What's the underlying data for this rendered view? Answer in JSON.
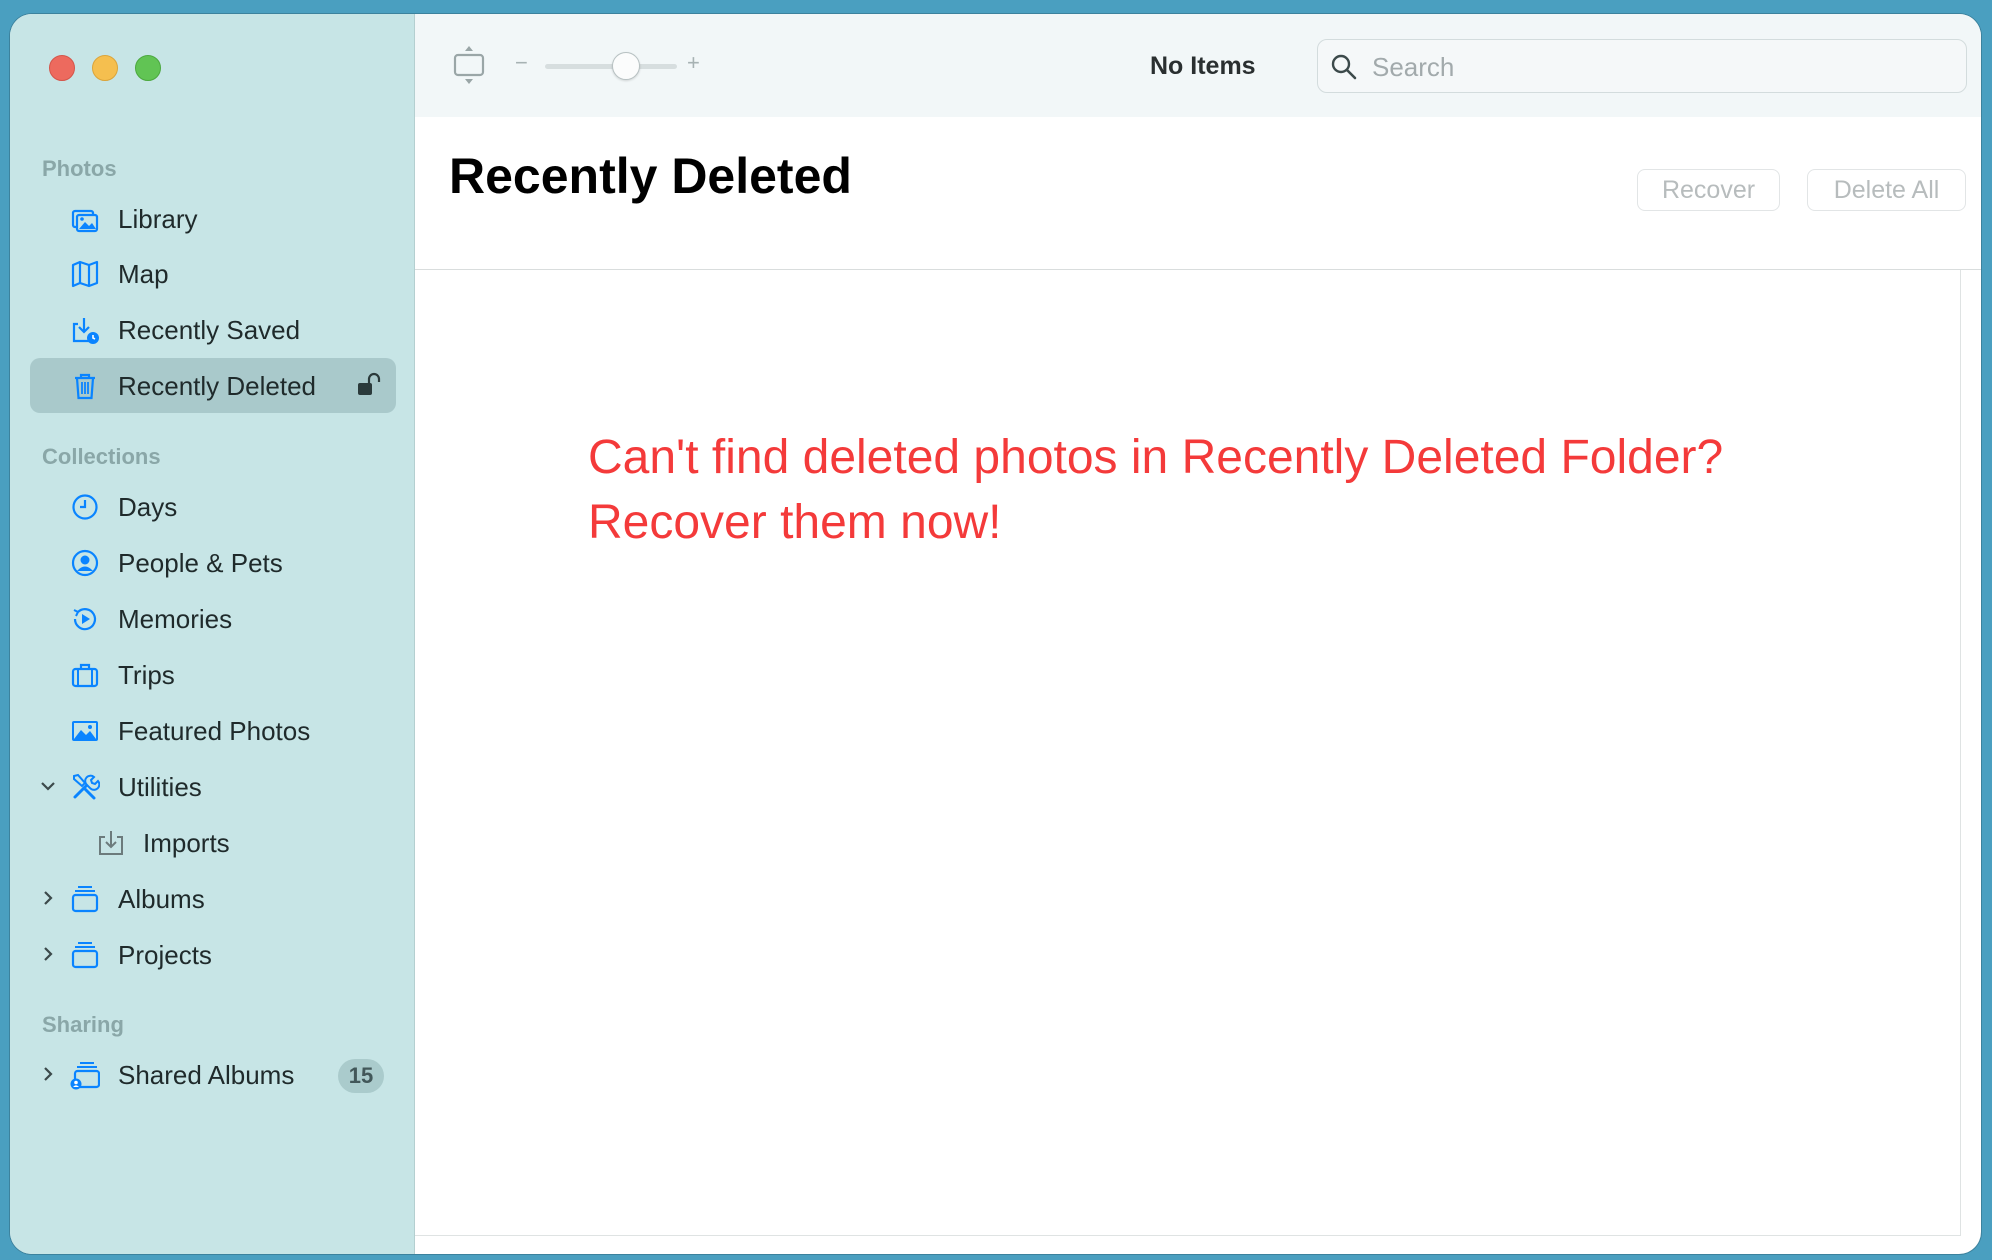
{
  "sidebar": {
    "sections": {
      "photos": "Photos",
      "collections": "Collections",
      "sharing": "Sharing"
    },
    "items": {
      "library": "Library",
      "map": "Map",
      "recently_saved": "Recently Saved",
      "recently_deleted": "Recently Deleted",
      "days": "Days",
      "people_pets": "People & Pets",
      "memories": "Memories",
      "trips": "Trips",
      "featured_photos": "Featured Photos",
      "utilities": "Utilities",
      "imports": "Imports",
      "albums": "Albums",
      "projects": "Projects",
      "shared_albums": "Shared Albums"
    },
    "shared_albums_count": "15",
    "selected": "recently_deleted",
    "accent_color": "#0a84ff"
  },
  "toolbar": {
    "title": "No Items",
    "zoom_minus": "−",
    "zoom_plus": "+",
    "search_placeholder": "Search"
  },
  "header": {
    "title": "Recently Deleted",
    "recover_label": "Recover",
    "delete_all_label": "Delete All"
  },
  "content": {
    "promo_line1": "Can't find deleted  photos in Recently Deleted Folder?",
    "promo_line2": "Recover them now!",
    "promo_color": "#f43a3a"
  }
}
